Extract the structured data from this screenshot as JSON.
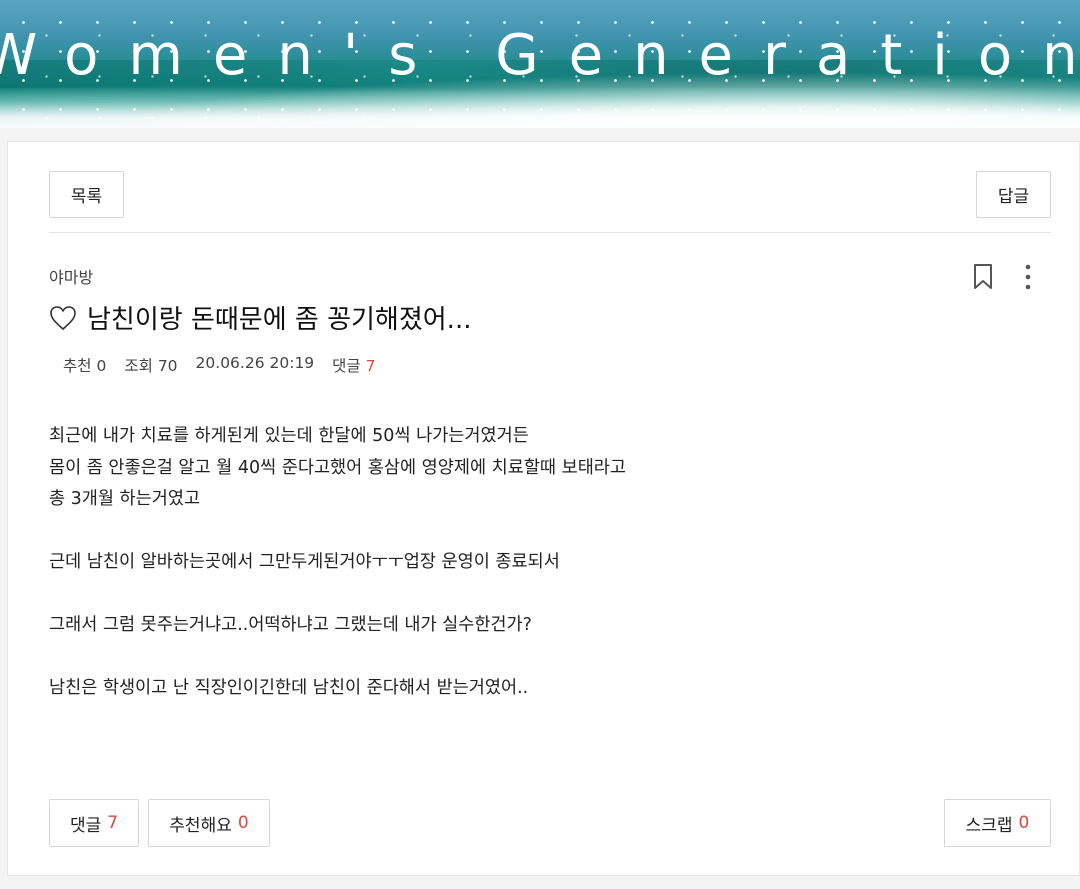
{
  "header": {
    "banner_title": "Women's Generation"
  },
  "toolbar": {
    "list_label": "목록",
    "reply_label": "답글"
  },
  "post": {
    "board_name": "야마방",
    "title": "남친이랑 돈때문에 좀 꽁기해졌어...",
    "meta": {
      "recommend_label": "추천",
      "recommend_count": "0",
      "views_label": "조회",
      "views_count": "70",
      "datetime": "20.06.26 20:19",
      "comments_label": "댓글",
      "comments_count": "7"
    },
    "body_lines": [
      "최근에 내가 치료를 하게된게 있는데 한달에 50씩 나가는거였거든",
      "몸이 좀 안좋은걸 알고 월 40씩 준다고했어 홍삼에 영양제에 치료할때 보태라고",
      "총 3개월 하는거였고",
      "",
      "근데 남친이 알바하는곳에서 그만두게된거야ㅜㅜ업장 운영이 종료되서",
      "",
      "그래서 그럼 못주는거냐고..어떡하냐고 그랬는데 내가 실수한건가?",
      "",
      "남친은 학생이고 난 직장인이긴한데 남친이 준다해서 받는거였어.."
    ]
  },
  "footer_actions": {
    "comment_label": "댓글",
    "comment_count": "7",
    "recommend_label": "추천해요",
    "recommend_count": "0",
    "scrap_label": "스크랩",
    "scrap_count": "0"
  },
  "colors": {
    "accent_red": "#e0463b",
    "border": "#d6d6d6"
  },
  "icons": [
    "heart-outline-icon",
    "bookmark-icon",
    "more-vertical-icon"
  ]
}
